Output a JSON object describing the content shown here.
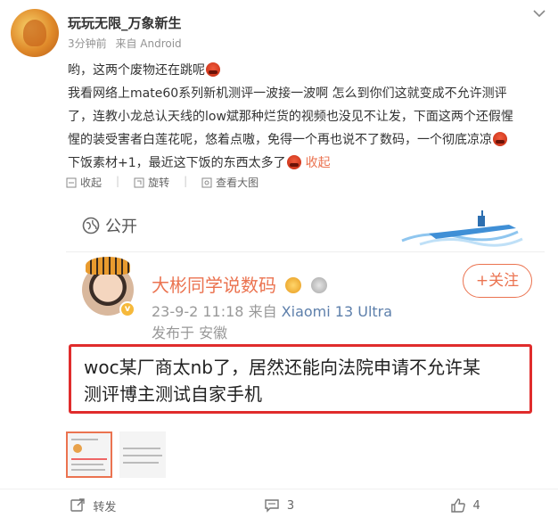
{
  "post": {
    "username": "玩玩无限_万象新生",
    "time": "3分钟前",
    "source": "来自 Android",
    "lines": [
      "哟，这两个废物还在跳呢",
      "我看网络上mate60系列新机测评一波接一波啊 怎么到你们这就变成不允许测评",
      "了，连教小龙总认天线的low斌那种烂货的视频也没见不让发，下面这两个还假惺",
      "惺的装受害者白莲花呢，悠着点嗷，免得一个再也说不了数码，一个彻底凉凉",
      "下饭素材+1，最近这下饭的东西太多了"
    ],
    "collapse_label": "收起"
  },
  "image_tools": {
    "collapse": "收起",
    "rotate": "旋转",
    "view_large": "查看大图"
  },
  "embedded": {
    "visibility": "公开",
    "author": "大彬同学说数码",
    "follow": "+关注",
    "datetime": "23-9-2 11:18",
    "source_prefix": "来自",
    "source_device": "Xiaomi 13 Ultra",
    "location": "发布于 安徽",
    "quote_line1": "woc某厂商太nb了，居然还能向法院申请不允许某",
    "quote_line2": "测评博主测试自家手机"
  },
  "footer": {
    "repost": "转发",
    "comments": "3",
    "likes": "4"
  },
  "colors": {
    "accent": "#eb7350",
    "highlight_border": "#e02c2c",
    "link_blue": "#5d7fab"
  }
}
